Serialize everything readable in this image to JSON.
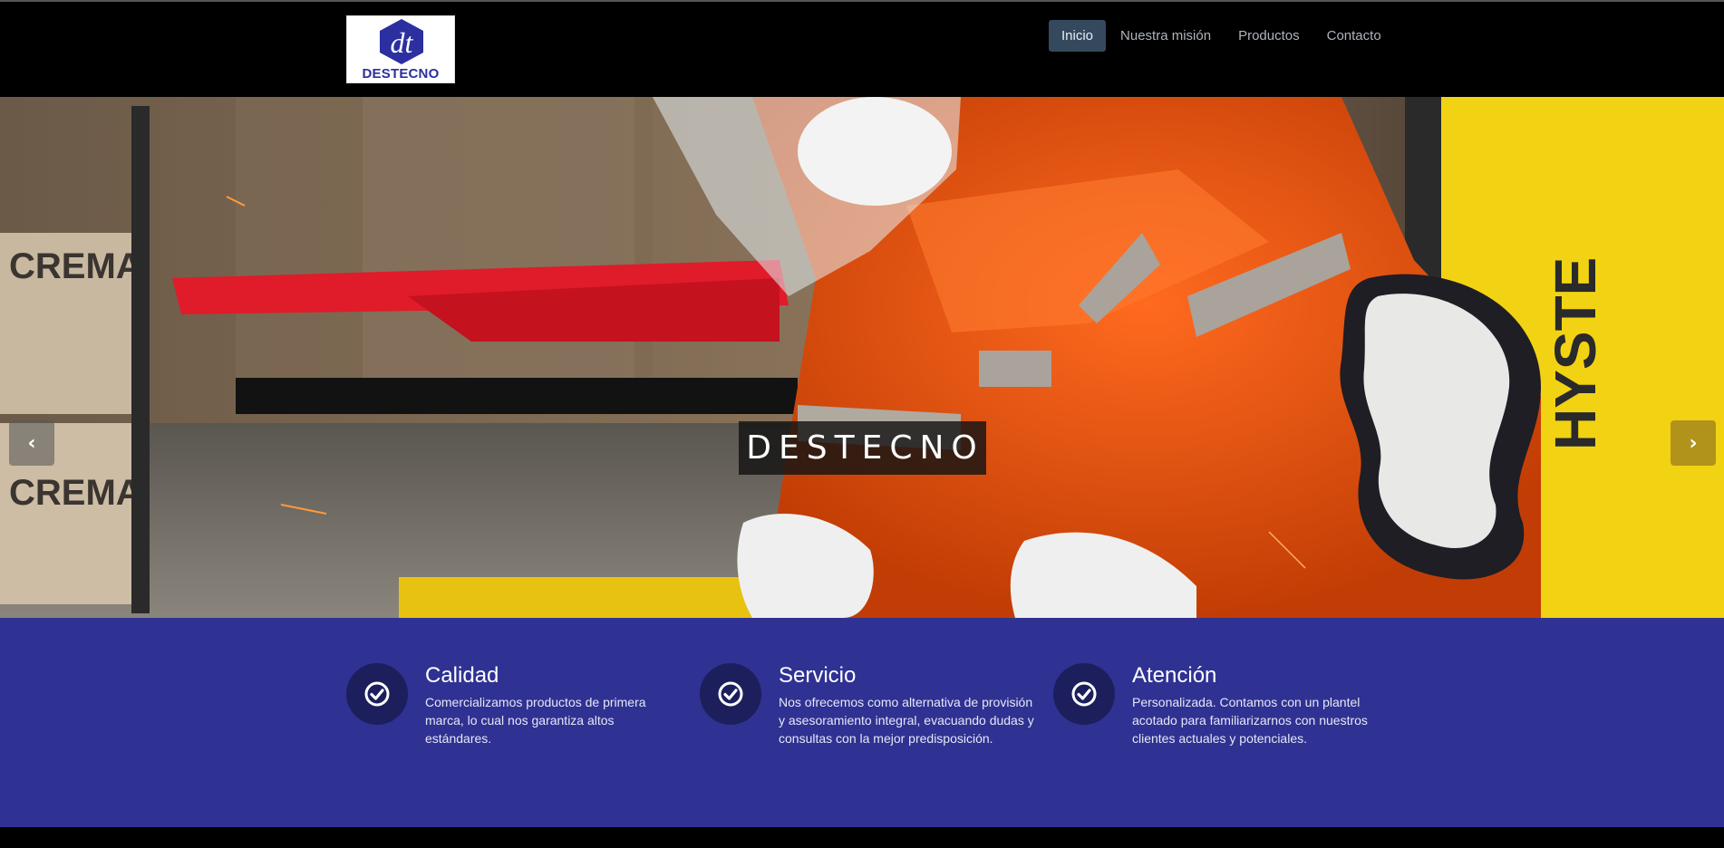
{
  "header": {
    "logo_text": "DESTECNO",
    "nav": [
      {
        "label": "Inicio",
        "active": true
      },
      {
        "label": "Nuestra misión",
        "active": false
      },
      {
        "label": "Productos",
        "active": false
      },
      {
        "label": "Contacto",
        "active": false
      }
    ]
  },
  "hero": {
    "title": "DESTECNO",
    "prev_icon": "chevron-left-icon",
    "next_icon": "chevron-right-icon"
  },
  "features": [
    {
      "title": "Calidad",
      "text": "Comercializamos productos de primera marca, lo cual nos garantiza altos estándares.",
      "icon": "check-circle-icon"
    },
    {
      "title": "Servicio",
      "text": "Nos ofrecemos como alternativa de provisión y asesoramiento integral, evacuando dudas y consultas con la mejor predisposición.",
      "icon": "check-circle-icon"
    },
    {
      "title": "Atención",
      "text": "Personalizada. Contamos con un plantel acotado para familiarizarnos con nuestros clientes actuales y potenciales.",
      "icon": "check-circle-icon"
    }
  ],
  "colors": {
    "brand_blue": "#2f3292",
    "nav_active": "#34495e",
    "header_bg": "#000000"
  }
}
